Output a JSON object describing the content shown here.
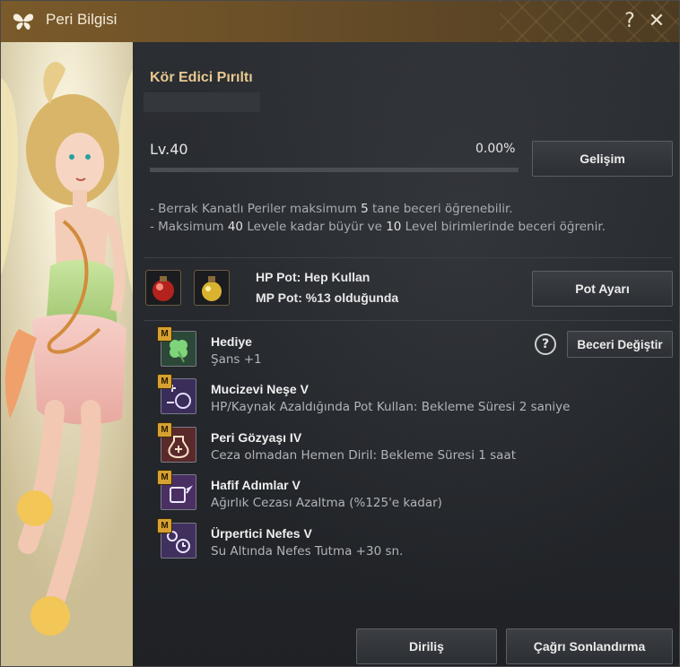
{
  "window": {
    "title": "Peri Bilgisi",
    "help_label": "?",
    "close_label": "✕"
  },
  "fairy": {
    "name": "Kör Edici Pırıltı",
    "level_label": "Lv.40",
    "progress_text": "0.00%",
    "progress_fraction": 0.0,
    "evolve_button": "Gelişim"
  },
  "info_lines": [
    {
      "pre": "- Berrak Kanatlı Periler maksimum ",
      "num": "5",
      "post": " tane beceri öğrenebilir."
    },
    {
      "pre": "- Maksimum ",
      "num": "40",
      "post": " Levele kadar büyür ve ",
      "num2": "10",
      "post2": " Level birimlerinde beceri öğrenir."
    }
  ],
  "pots": {
    "hp_label": "HP Pot: Hep Kullan",
    "mp_label": "MP Pot: %13 olduğunda",
    "settings_button": "Pot Ayarı"
  },
  "skills_header": {
    "help_label": "?",
    "change_button": "Beceri Değiştir"
  },
  "skills": [
    {
      "badge": "M",
      "title": "Hediye",
      "desc": "Şans +1",
      "icon": "clover-icon"
    },
    {
      "badge": "M",
      "title": "Mucizevi Neşe V",
      "desc": "HP/Kaynak Azaldığında Pot Kullan: Bekleme Süresi 2 saniye",
      "icon": "potion-plus-icon"
    },
    {
      "badge": "M",
      "title": "Peri Gözyaşı IV",
      "desc": "Ceza olmadan Hemen Diril: Bekleme Süresi 1 saat",
      "icon": "revive-potion-icon"
    },
    {
      "badge": "M",
      "title": "Hafif Adımlar V",
      "desc": "Ağırlık Cezası Azaltma (%125'e kadar)",
      "icon": "weight-icon"
    },
    {
      "badge": "M",
      "title": "Ürpertici Nefes V",
      "desc": "Su Altında Nefes Tutma +30 sn.",
      "icon": "bubble-timer-icon"
    }
  ],
  "footer": {
    "revive_button": "Diriliş",
    "end_summon_button": "Çağrı Sonlandırma"
  },
  "colors": {
    "title_bar": "#7a5a2a",
    "accent_gold": "#e9c98f",
    "badge": "#d7a12f"
  }
}
